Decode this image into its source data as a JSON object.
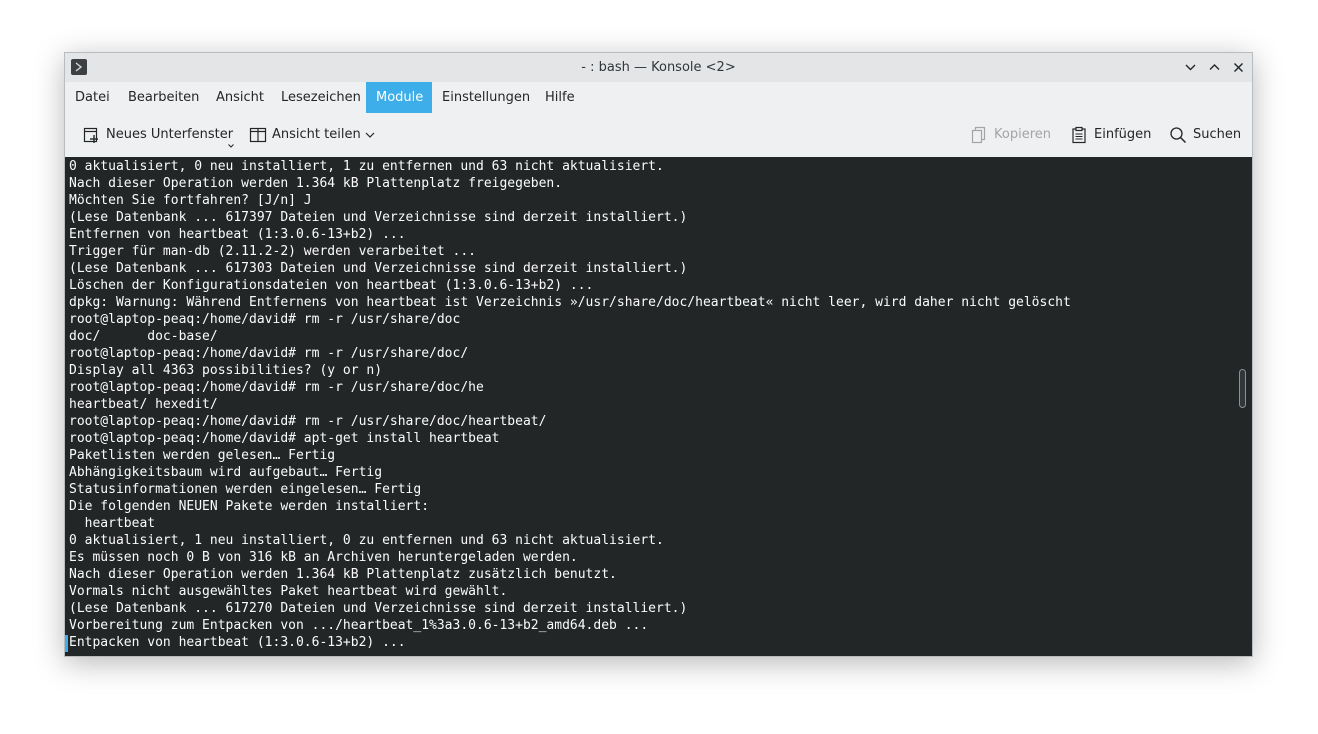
{
  "window": {
    "title": "- : bash — Konsole <2>"
  },
  "menubar": {
    "items": [
      "Datei",
      "Bearbeiten",
      "Ansicht",
      "Lesezeichen",
      "Module",
      "Einstellungen",
      "Hilfe"
    ],
    "active": "Module"
  },
  "toolbar": {
    "new_tab": "Neues Unterfenster",
    "split_view": "Ansicht teilen",
    "copy": "Kopieren",
    "paste": "Einfügen",
    "find": "Suchen"
  },
  "terminal": {
    "lines": [
      "0 aktualisiert, 0 neu installiert, 1 zu entfernen und 63 nicht aktualisiert.",
      "Nach dieser Operation werden 1.364 kB Plattenplatz freigegeben.",
      "Möchten Sie fortfahren? [J/n] J",
      "(Lese Datenbank ... 617397 Dateien und Verzeichnisse sind derzeit installiert.)",
      "Entfernen von heartbeat (1:3.0.6-13+b2) ...",
      "Trigger für man-db (2.11.2-2) werden verarbeitet ...",
      "(Lese Datenbank ... 617303 Dateien und Verzeichnisse sind derzeit installiert.)",
      "Löschen der Konfigurationsdateien von heartbeat (1:3.0.6-13+b2) ...",
      "dpkg: Warnung: Während Entfernens von heartbeat ist Verzeichnis »/usr/share/doc/heartbeat« nicht leer, wird daher nicht gelöscht",
      "root@laptop-peaq:/home/david# rm -r /usr/share/doc",
      "doc/      doc-base/",
      "root@laptop-peaq:/home/david# rm -r /usr/share/doc/",
      "Display all 4363 possibilities? (y or n)",
      "root@laptop-peaq:/home/david# rm -r /usr/share/doc/he",
      "heartbeat/ hexedit/",
      "root@laptop-peaq:/home/david# rm -r /usr/share/doc/heartbeat/",
      "root@laptop-peaq:/home/david# apt-get install heartbeat",
      "Paketlisten werden gelesen… Fertig",
      "Abhängigkeitsbaum wird aufgebaut… Fertig",
      "Statusinformationen werden eingelesen… Fertig",
      "Die folgenden NEUEN Pakete werden installiert:",
      "  heartbeat",
      "0 aktualisiert, 1 neu installiert, 0 zu entfernen und 63 nicht aktualisiert.",
      "Es müssen noch 0 B von 316 kB an Archiven heruntergeladen werden.",
      "Nach dieser Operation werden 1.364 kB Plattenplatz zusätzlich benutzt.",
      "Vormals nicht ausgewähltes Paket heartbeat wird gewählt.",
      "(Lese Datenbank ... 617270 Dateien und Verzeichnisse sind derzeit installiert.)",
      "Vorbereitung zum Entpacken von .../heartbeat_1%3a3.0.6-13+b2_amd64.deb ...",
      "Entpacken von heartbeat (1:3.0.6-13+b2) ..."
    ]
  },
  "colors": {
    "accent": "#3daee9",
    "terminal_bg": "#232627",
    "terminal_fg": "#fcfcfc",
    "chrome_bg": "#eff0f1"
  },
  "icons": {
    "app": "konsole-icon",
    "minimize": "chevron-down-icon",
    "maximize": "chevron-up-icon",
    "close": "close-icon",
    "new_tab": "new-tab-icon",
    "split_view": "split-view-icon",
    "copy": "copy-icon",
    "paste": "paste-icon",
    "find": "search-icon"
  }
}
